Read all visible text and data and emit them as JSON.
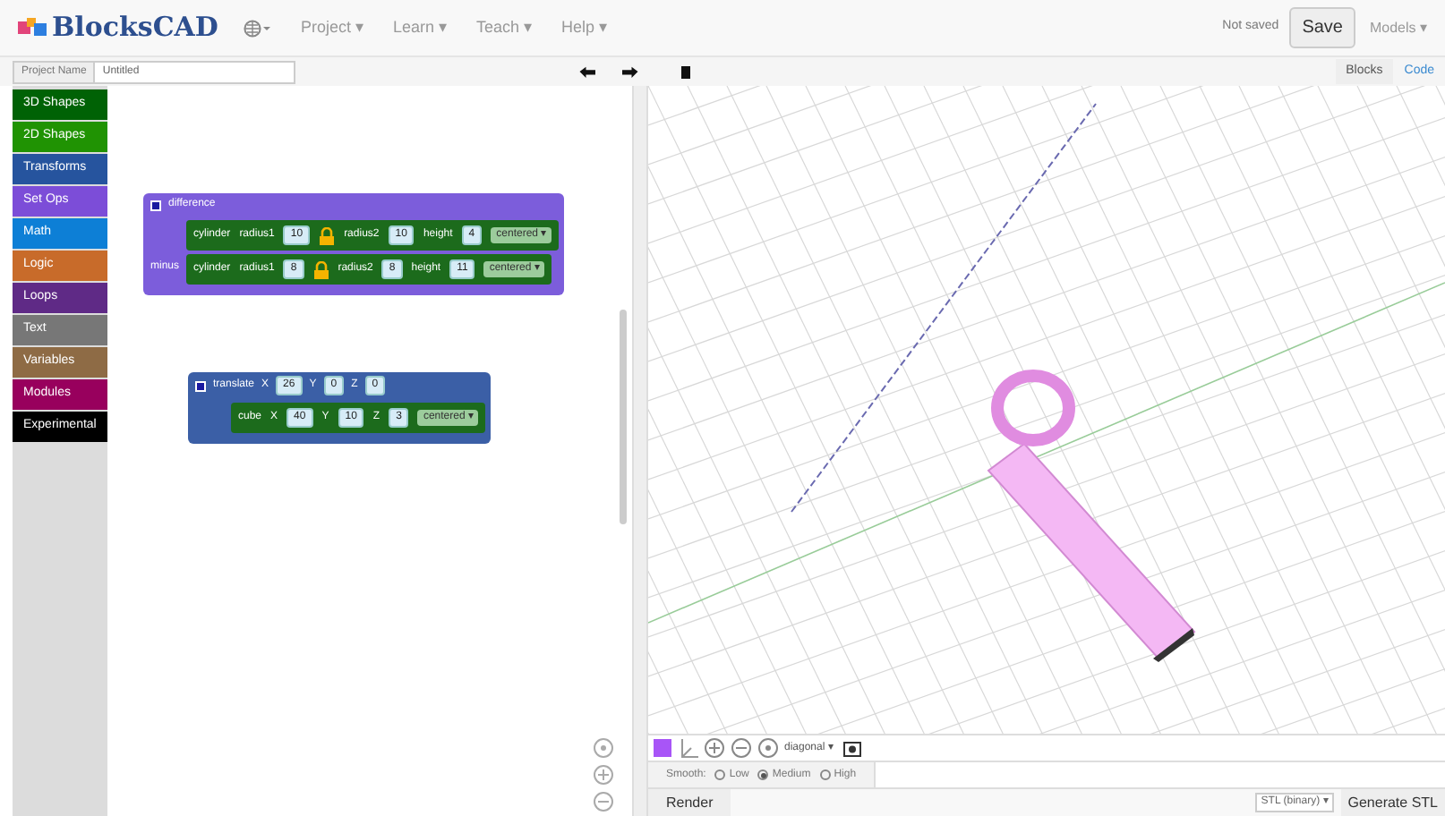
{
  "header": {
    "logo": "BlocksCAD",
    "menus": [
      "Project ▾",
      "Learn ▾",
      "Teach ▾",
      "Help ▾"
    ],
    "save_status": "Not saved",
    "save_button": "Save",
    "models_menu": "Models ▾"
  },
  "toolbar": {
    "project_name_label": "Project Name",
    "project_name": "Untitled",
    "view_tabs": [
      {
        "label": "Blocks",
        "selected": true
      },
      {
        "label": "Code",
        "selected": false
      }
    ]
  },
  "categories": [
    {
      "label": "3D Shapes",
      "color": "#006205"
    },
    {
      "label": "2D Shapes",
      "color": "#209303"
    },
    {
      "label": "Transforms",
      "color": "#26549e"
    },
    {
      "label": "Set Ops",
      "color": "#7c4dd8"
    },
    {
      "label": "Math",
      "color": "#0d7fd6"
    },
    {
      "label": "Logic",
      "color": "#c86b2a"
    },
    {
      "label": "Loops",
      "color": "#5f2a86"
    },
    {
      "label": "Text",
      "color": "#777777"
    },
    {
      "label": "Variables",
      "color": "#8e6b45"
    },
    {
      "label": "Modules",
      "color": "#98005d"
    },
    {
      "label": "Experimental",
      "color": "#000000"
    }
  ],
  "blocks": [
    {
      "kind": "setop",
      "head": [
        {
          "kind": "text",
          "text": "difference"
        }
      ],
      "rows": [
        {
          "label": "",
          "items": [
            {
              "kind": "text",
              "text": "cylinder"
            },
            {
              "kind": "text",
              "text": "radius1"
            },
            {
              "kind": "num",
              "text": "10"
            },
            {
              "kind": "lock"
            },
            {
              "kind": "text",
              "text": "radius2"
            },
            {
              "kind": "num",
              "text": "10"
            },
            {
              "kind": "text",
              "text": "height"
            },
            {
              "kind": "num",
              "text": "4"
            },
            {
              "kind": "dropdown",
              "text": "centered ▾"
            }
          ]
        },
        {
          "label": "minus",
          "items": [
            {
              "kind": "text",
              "text": "cylinder"
            },
            {
              "kind": "text",
              "text": "radius1"
            },
            {
              "kind": "num",
              "text": "8"
            },
            {
              "kind": "lock"
            },
            {
              "kind": "text",
              "text": "radius2"
            },
            {
              "kind": "num",
              "text": "8"
            },
            {
              "kind": "text",
              "text": "height"
            },
            {
              "kind": "num",
              "text": "11"
            },
            {
              "kind": "dropdown",
              "text": "centered ▾"
            }
          ]
        }
      ]
    },
    {
      "kind": "transform",
      "head": [
        {
          "kind": "text",
          "text": "translate"
        },
        {
          "kind": "text",
          "text": "X"
        },
        {
          "kind": "num",
          "text": "26"
        },
        {
          "kind": "text",
          "text": "Y"
        },
        {
          "kind": "num",
          "text": "0"
        },
        {
          "kind": "text",
          "text": "Z"
        },
        {
          "kind": "num",
          "text": "0"
        }
      ],
      "rows": [
        {
          "label": "",
          "items": [
            {
              "kind": "text",
              "text": "cube"
            },
            {
              "kind": "text",
              "text": "X"
            },
            {
              "kind": "num",
              "text": "40"
            },
            {
              "kind": "text",
              "text": "Y"
            },
            {
              "kind": "num",
              "text": "10"
            },
            {
              "kind": "text",
              "text": "Z"
            },
            {
              "kind": "num",
              "text": "3"
            },
            {
              "kind": "dropdown",
              "text": "centered ▾"
            }
          ]
        }
      ]
    }
  ],
  "viewer": {
    "view_dropdown": "diagonal ▾",
    "smooth_label": "Smooth:",
    "smooth_options": [
      {
        "label": "Low",
        "selected": false
      },
      {
        "label": "Medium",
        "selected": true
      },
      {
        "label": "High",
        "selected": false
      }
    ],
    "render_button": "Render",
    "format_dropdown": "STL (binary) ▾",
    "generate_button": "Generate STL"
  }
}
